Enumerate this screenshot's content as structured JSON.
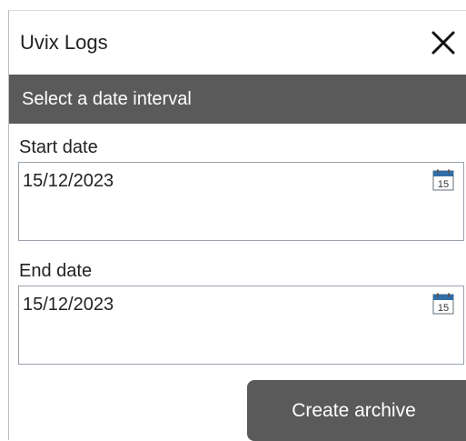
{
  "window": {
    "title": "Uvix Logs"
  },
  "subheader": {
    "text": "Select a date interval"
  },
  "start_date": {
    "label": "Start date",
    "value": "15/12/2023",
    "calendar_icon": "calendar-icon",
    "calendar_day": "15"
  },
  "end_date": {
    "label": "End date",
    "value": "15/12/2023",
    "calendar_icon": "calendar-icon",
    "calendar_day": "15"
  },
  "actions": {
    "create_label": "Create archive"
  },
  "colors": {
    "header_bg": "#5a5a5a",
    "button_bg": "#5a5a5a",
    "field_border": "#9aa3ad",
    "calendar_accent": "#2f6ea8"
  }
}
